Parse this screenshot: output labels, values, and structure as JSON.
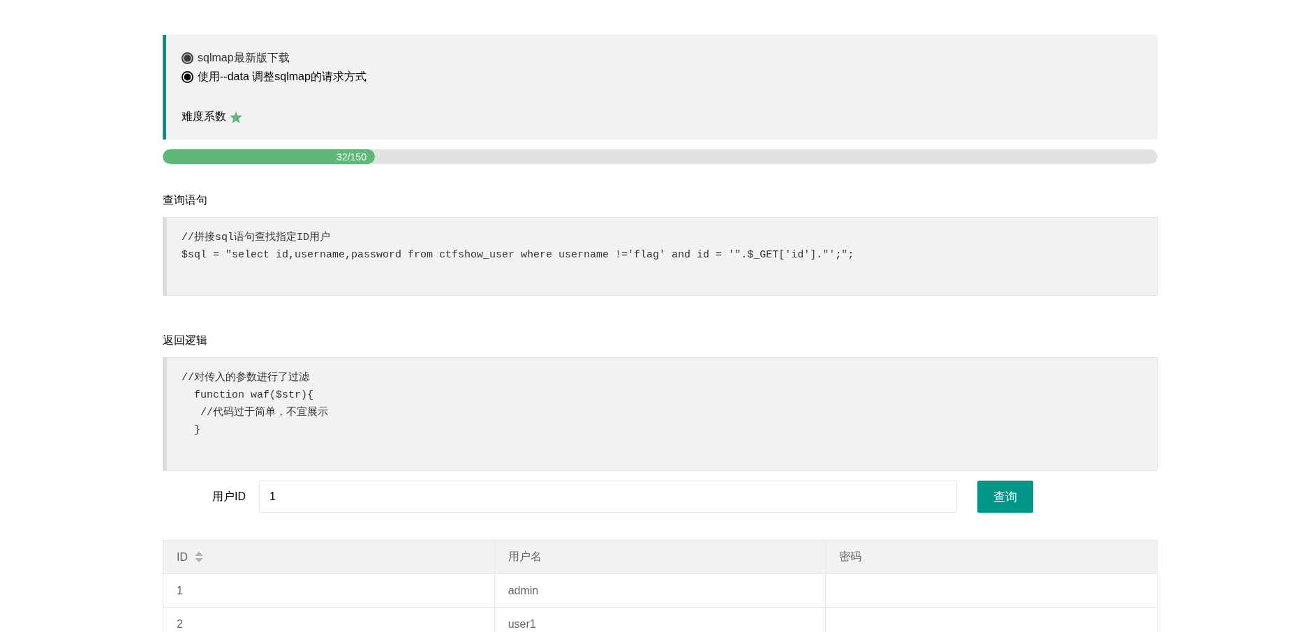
{
  "hints": {
    "items": [
      {
        "kind": "link",
        "text": "sqlmap最新版下载"
      },
      {
        "kind": "text",
        "text": "使用--data 调整sqlmap的请求方式"
      }
    ],
    "difficulty": {
      "label": "难度系数"
    }
  },
  "progress": {
    "label": "32/150",
    "level": 0.2133
  },
  "sections": [
    {
      "title": "查询语句",
      "code": [
        "//拼接sql语句查找指定ID用户",
        "$sql = \"select id,username,password from ctfshow_user where username !='flag' and id = '\".$_GET['id'].\"';\";"
      ]
    },
    {
      "title": "返回逻辑",
      "code": [
        "//对传入的参数进行了过滤",
        "  function waf($str){",
        "   //代码过于简单，不宜展示",
        "  }"
      ]
    }
  ],
  "form": {
    "label": "用户ID",
    "value": "1",
    "button": "查询"
  },
  "table": {
    "columns": [
      {
        "kind": "sortable",
        "label": "ID"
      },
      {
        "kind": "plain",
        "label": "用户名"
      },
      {
        "kind": "plain",
        "label": "密码"
      }
    ],
    "rows": [
      {
        "cells": [
          "1",
          "admin"
        ]
      },
      {
        "cells": [
          "2",
          "user1"
        ]
      }
    ]
  }
}
